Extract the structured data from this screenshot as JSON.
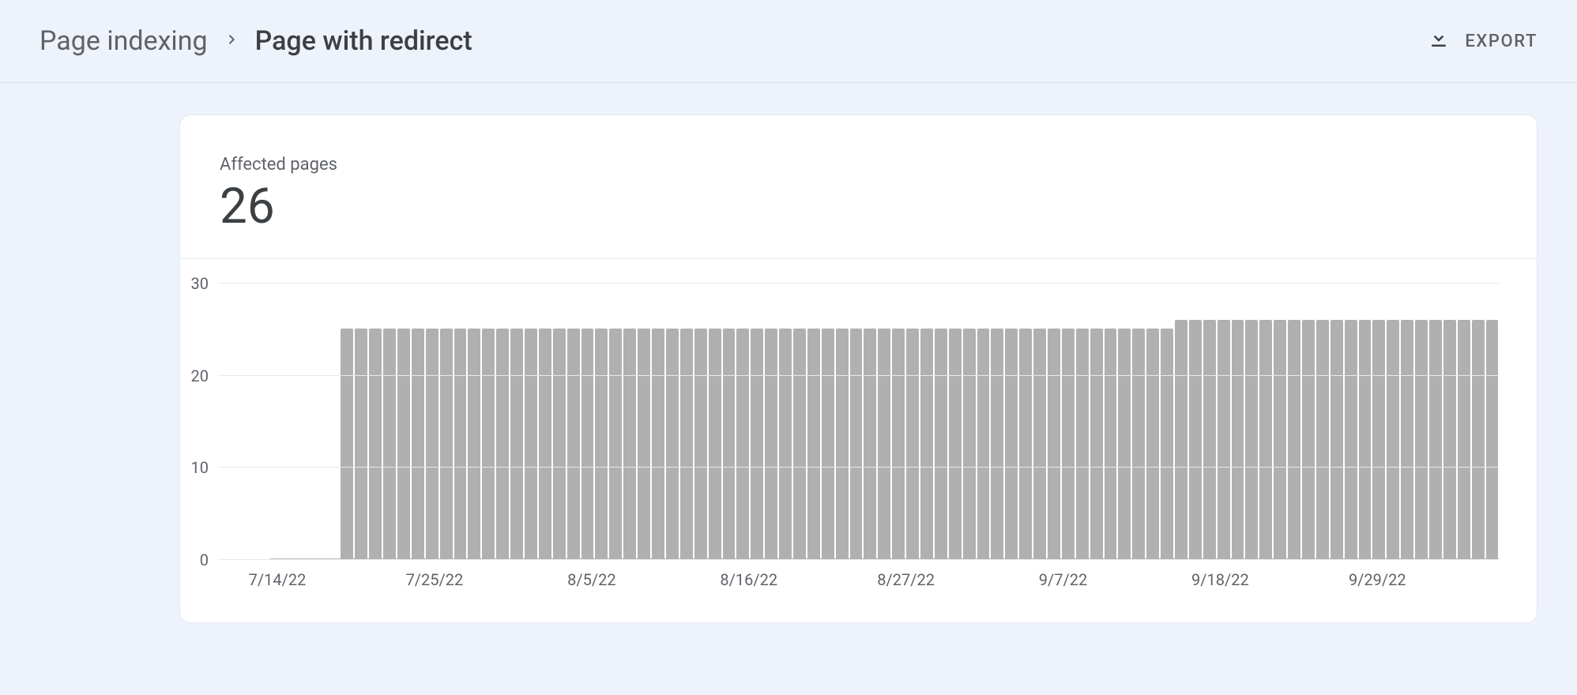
{
  "breadcrumb": {
    "parent_label": "Page indexing",
    "current_label": "Page with redirect"
  },
  "export_label": "EXPORT",
  "card": {
    "metric_label": "Affected pages",
    "metric_value": "26"
  },
  "chart_data": {
    "type": "bar",
    "ylabel": "",
    "xlabel": "",
    "ylim": [
      0,
      30
    ],
    "y_ticks": [
      0,
      10,
      20,
      30
    ],
    "x_ticks": [
      "7/14/22",
      "7/25/22",
      "8/5/22",
      "8/16/22",
      "8/27/22",
      "9/7/22",
      "9/18/22",
      "9/29/22"
    ],
    "categories": [
      "7/14/22",
      "7/15/22",
      "7/16/22",
      "7/17/22",
      "7/18/22",
      "7/19/22",
      "7/20/22",
      "7/21/22",
      "7/22/22",
      "7/23/22",
      "7/24/22",
      "7/25/22",
      "7/26/22",
      "7/27/22",
      "7/28/22",
      "7/29/22",
      "7/30/22",
      "7/31/22",
      "8/1/22",
      "8/2/22",
      "8/3/22",
      "8/4/22",
      "8/5/22",
      "8/6/22",
      "8/7/22",
      "8/8/22",
      "8/9/22",
      "8/10/22",
      "8/11/22",
      "8/12/22",
      "8/13/22",
      "8/14/22",
      "8/15/22",
      "8/16/22",
      "8/17/22",
      "8/18/22",
      "8/19/22",
      "8/20/22",
      "8/21/22",
      "8/22/22",
      "8/23/22",
      "8/24/22",
      "8/25/22",
      "8/26/22",
      "8/27/22",
      "8/28/22",
      "8/29/22",
      "8/30/22",
      "8/31/22",
      "9/1/22",
      "9/2/22",
      "9/3/22",
      "9/4/22",
      "9/5/22",
      "9/6/22",
      "9/7/22",
      "9/8/22",
      "9/9/22",
      "9/10/22",
      "9/11/22",
      "9/12/22",
      "9/13/22",
      "9/14/22",
      "9/15/22",
      "9/16/22",
      "9/17/22",
      "9/18/22",
      "9/19/22",
      "9/20/22",
      "9/21/22",
      "9/22/22",
      "9/23/22",
      "9/24/22",
      "9/25/22",
      "9/26/22",
      "9/27/22",
      "9/28/22",
      "9/29/22",
      "9/30/22",
      "10/1/22",
      "10/2/22",
      "10/3/22",
      "10/4/22",
      "10/5/22",
      "10/6/22",
      "10/7/22"
    ],
    "values": [
      0,
      0,
      0,
      0,
      0,
      25,
      25,
      25,
      25,
      25,
      25,
      25,
      25,
      25,
      25,
      25,
      25,
      25,
      25,
      25,
      25,
      25,
      25,
      25,
      25,
      25,
      25,
      25,
      25,
      25,
      25,
      25,
      25,
      25,
      25,
      25,
      25,
      25,
      25,
      25,
      25,
      25,
      25,
      25,
      25,
      25,
      25,
      25,
      25,
      25,
      25,
      25,
      25,
      25,
      25,
      25,
      25,
      25,
      25,
      25,
      25,
      25,
      25,
      25,
      26,
      26,
      26,
      26,
      26,
      26,
      26,
      26,
      26,
      26,
      26,
      26,
      26,
      26,
      26,
      26,
      26,
      26,
      26,
      26,
      26,
      26,
      26
    ]
  }
}
